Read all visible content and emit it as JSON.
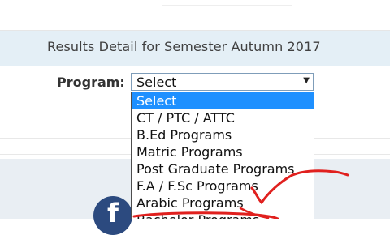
{
  "header": {
    "title": "Results Detail for Semester Autumn 2017"
  },
  "form": {
    "program_label": "Program:",
    "select_value": "Select",
    "options": [
      "Select",
      "CT / PTC / ATTC",
      "B.Ed Programs",
      "Matric Programs",
      "Post Graduate Programs",
      "F.A / F.Sc Programs",
      "Arabic Programs",
      "Bachelor Programs"
    ],
    "highlighted_index": 0
  },
  "colors": {
    "band": "#e4eff6",
    "selected_option": "#1e90ff",
    "annotation": "#e0201e",
    "facebook": "#2c4a7f"
  },
  "icons": {
    "dropdown_arrow": "triangle-down-icon",
    "social": "facebook-icon"
  }
}
